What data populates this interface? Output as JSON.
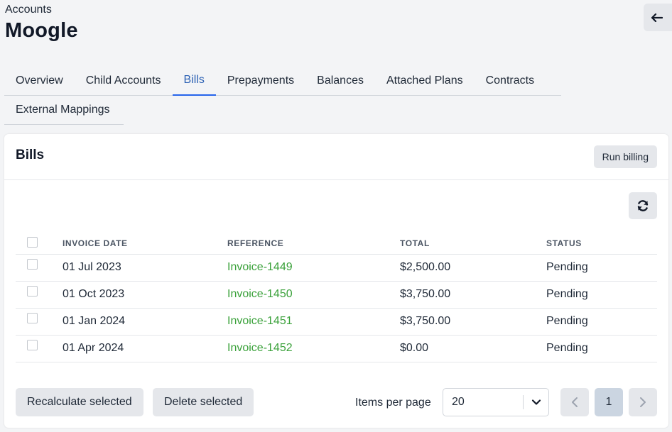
{
  "header": {
    "breadcrumb": "Accounts",
    "title": "Moogle",
    "back_icon": "arrow-left-icon"
  },
  "tabs": [
    {
      "label": "Overview",
      "active": false
    },
    {
      "label": "Child Accounts",
      "active": false
    },
    {
      "label": "Bills",
      "active": true
    },
    {
      "label": "Prepayments",
      "active": false
    },
    {
      "label": "Balances",
      "active": false
    },
    {
      "label": "Attached Plans",
      "active": false
    },
    {
      "label": "Contracts",
      "active": false
    },
    {
      "label": "External Mappings",
      "active": false
    }
  ],
  "bills": {
    "title": "Bills",
    "run_billing_label": "Run billing",
    "refresh_icon": "refresh-icon",
    "columns": [
      "INVOICE DATE",
      "REFERENCE",
      "TOTAL",
      "STATUS"
    ],
    "rows": [
      {
        "date": "01 Jul 2023",
        "reference": "Invoice-1449",
        "total": "$2,500.00",
        "status": "Pending"
      },
      {
        "date": "01 Oct 2023",
        "reference": "Invoice-1450",
        "total": "$3,750.00",
        "status": "Pending"
      },
      {
        "date": "01 Jan 2024",
        "reference": "Invoice-1451",
        "total": "$3,750.00",
        "status": "Pending"
      },
      {
        "date": "01 Apr 2024",
        "reference": "Invoice-1452",
        "total": "$0.00",
        "status": "Pending"
      }
    ]
  },
  "footer": {
    "recalculate_label": "Recalculate selected",
    "delete_label": "Delete selected",
    "items_per_page_label": "Items per page",
    "items_per_page_value": "20",
    "current_page": "1"
  },
  "colors": {
    "link": "#3aa13a",
    "active_tab": "#2f63b5",
    "button_bg": "#e5e7eb"
  }
}
